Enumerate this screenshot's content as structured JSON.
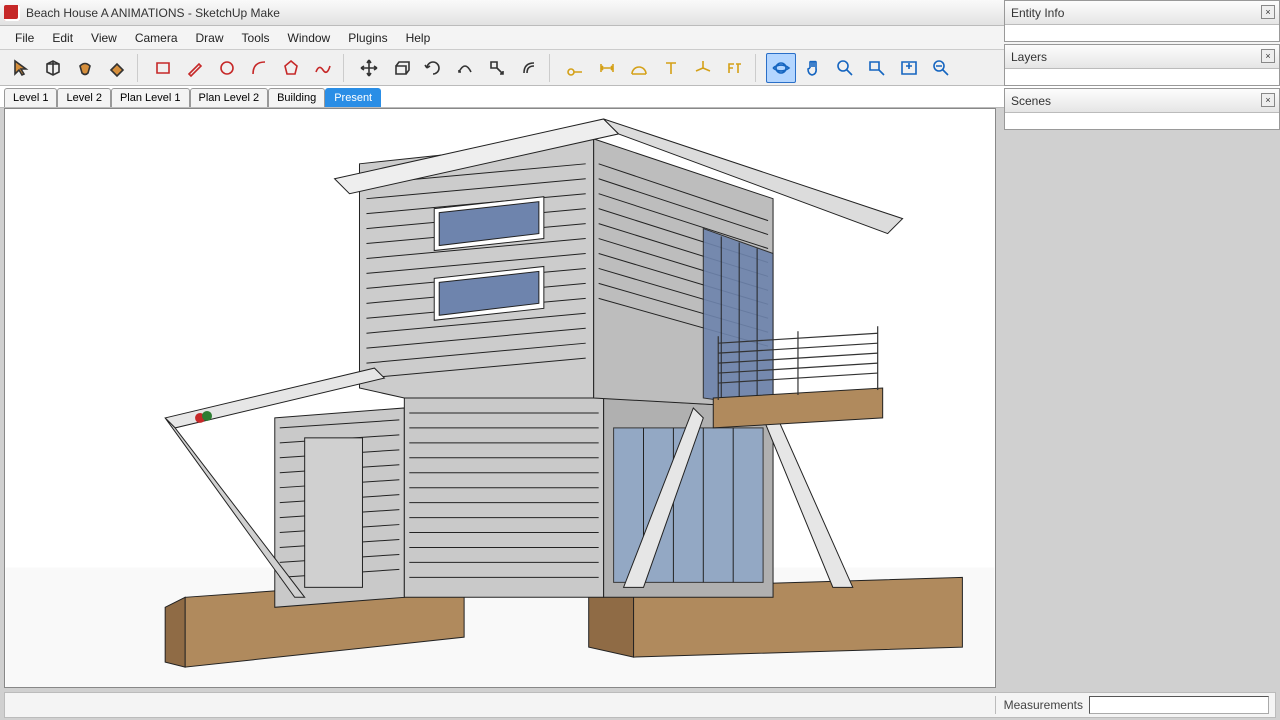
{
  "window": {
    "title": "Beach House A ANIMATIONS - SketchUp Make"
  },
  "menu": {
    "items": [
      "File",
      "Edit",
      "View",
      "Camera",
      "Draw",
      "Tools",
      "Window",
      "Plugins",
      "Help"
    ]
  },
  "toolbar": {
    "tools": [
      {
        "name": "select-tool",
        "icon": "cursor"
      },
      {
        "name": "make-component-tool",
        "icon": "box"
      },
      {
        "name": "paint-bucket-tool",
        "icon": "bucket"
      },
      {
        "name": "eraser-tool",
        "icon": "eraser"
      },
      {
        "sep": true
      },
      {
        "name": "rectangle-tool",
        "icon": "rect"
      },
      {
        "name": "line-tool",
        "icon": "pencil"
      },
      {
        "name": "circle-tool",
        "icon": "circle"
      },
      {
        "name": "arc-tool",
        "icon": "arc"
      },
      {
        "name": "polygon-tool",
        "icon": "poly"
      },
      {
        "name": "freehand-tool",
        "icon": "free"
      },
      {
        "sep": true
      },
      {
        "name": "move-tool",
        "icon": "move"
      },
      {
        "name": "push-pull-tool",
        "icon": "push"
      },
      {
        "name": "rotate-tool",
        "icon": "rotate"
      },
      {
        "name": "follow-me-tool",
        "icon": "follow"
      },
      {
        "name": "scale-tool",
        "icon": "scale"
      },
      {
        "name": "offset-tool",
        "icon": "offset"
      },
      {
        "sep": true
      },
      {
        "name": "tape-measure-tool",
        "icon": "tape"
      },
      {
        "name": "dimension-tool",
        "icon": "dim"
      },
      {
        "name": "protractor-tool",
        "icon": "prot"
      },
      {
        "name": "text-tool",
        "icon": "text"
      },
      {
        "name": "axes-tool",
        "icon": "axes"
      },
      {
        "name": "3d-text-tool",
        "icon": "3dtext"
      },
      {
        "sep": true
      },
      {
        "name": "orbit-tool",
        "icon": "orbit",
        "active": true
      },
      {
        "name": "pan-tool",
        "icon": "pan"
      },
      {
        "name": "zoom-tool",
        "icon": "zoom"
      },
      {
        "name": "zoom-window-tool",
        "icon": "zoomw"
      },
      {
        "name": "zoom-extents-tool",
        "icon": "zoome"
      },
      {
        "name": "previous-tool",
        "icon": "prev"
      }
    ]
  },
  "scene_tabs": [
    {
      "label": "Level 1",
      "active": false
    },
    {
      "label": "Level 2",
      "active": false
    },
    {
      "label": "Plan Level 1",
      "active": false
    },
    {
      "label": "Plan Level 2",
      "active": false
    },
    {
      "label": "Building",
      "active": false
    },
    {
      "label": "Present",
      "active": true
    }
  ],
  "panels": {
    "entity_info": "Entity Info",
    "layers": "Layers",
    "scenes": "Scenes"
  },
  "statusbar": {
    "measurements_label": "Measurements"
  }
}
